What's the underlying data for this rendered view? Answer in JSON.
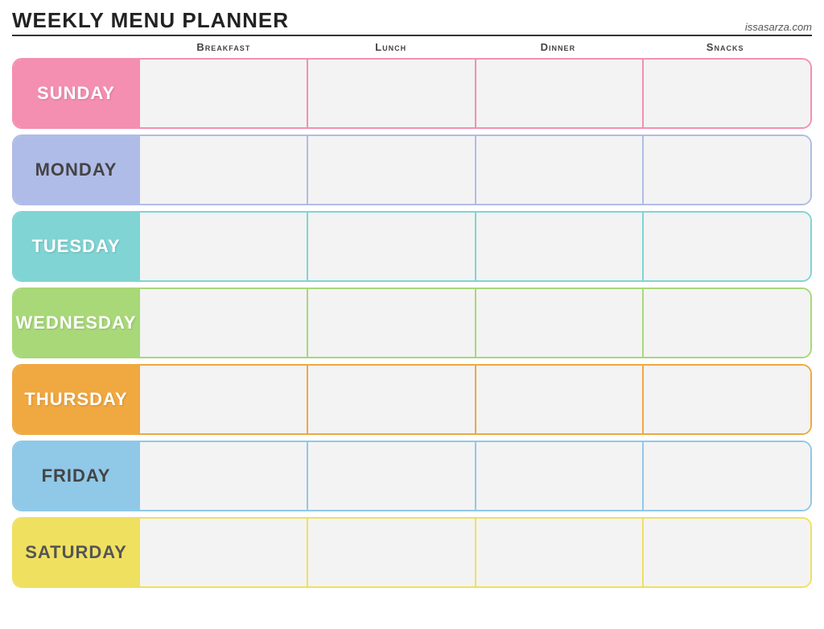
{
  "header": {
    "title": "Weekly Menu Planner",
    "website": "issasarza.com"
  },
  "columns": {
    "empty": "",
    "breakfast": "Breakfast",
    "lunch": "Lunch",
    "dinner": "Dinner",
    "snacks": "Snacks"
  },
  "days": [
    {
      "id": "sunday",
      "label": "Sunday",
      "colorClass": "row-sunday"
    },
    {
      "id": "monday",
      "label": "Monday",
      "colorClass": "row-monday"
    },
    {
      "id": "tuesday",
      "label": "Tuesday",
      "colorClass": "row-tuesday"
    },
    {
      "id": "wednesday",
      "label": "Wednesday",
      "colorClass": "row-wednesday"
    },
    {
      "id": "thursday",
      "label": "Thursday",
      "colorClass": "row-thursday"
    },
    {
      "id": "friday",
      "label": "Friday",
      "colorClass": "row-friday"
    },
    {
      "id": "saturday",
      "label": "Saturday",
      "colorClass": "row-saturday"
    }
  ]
}
